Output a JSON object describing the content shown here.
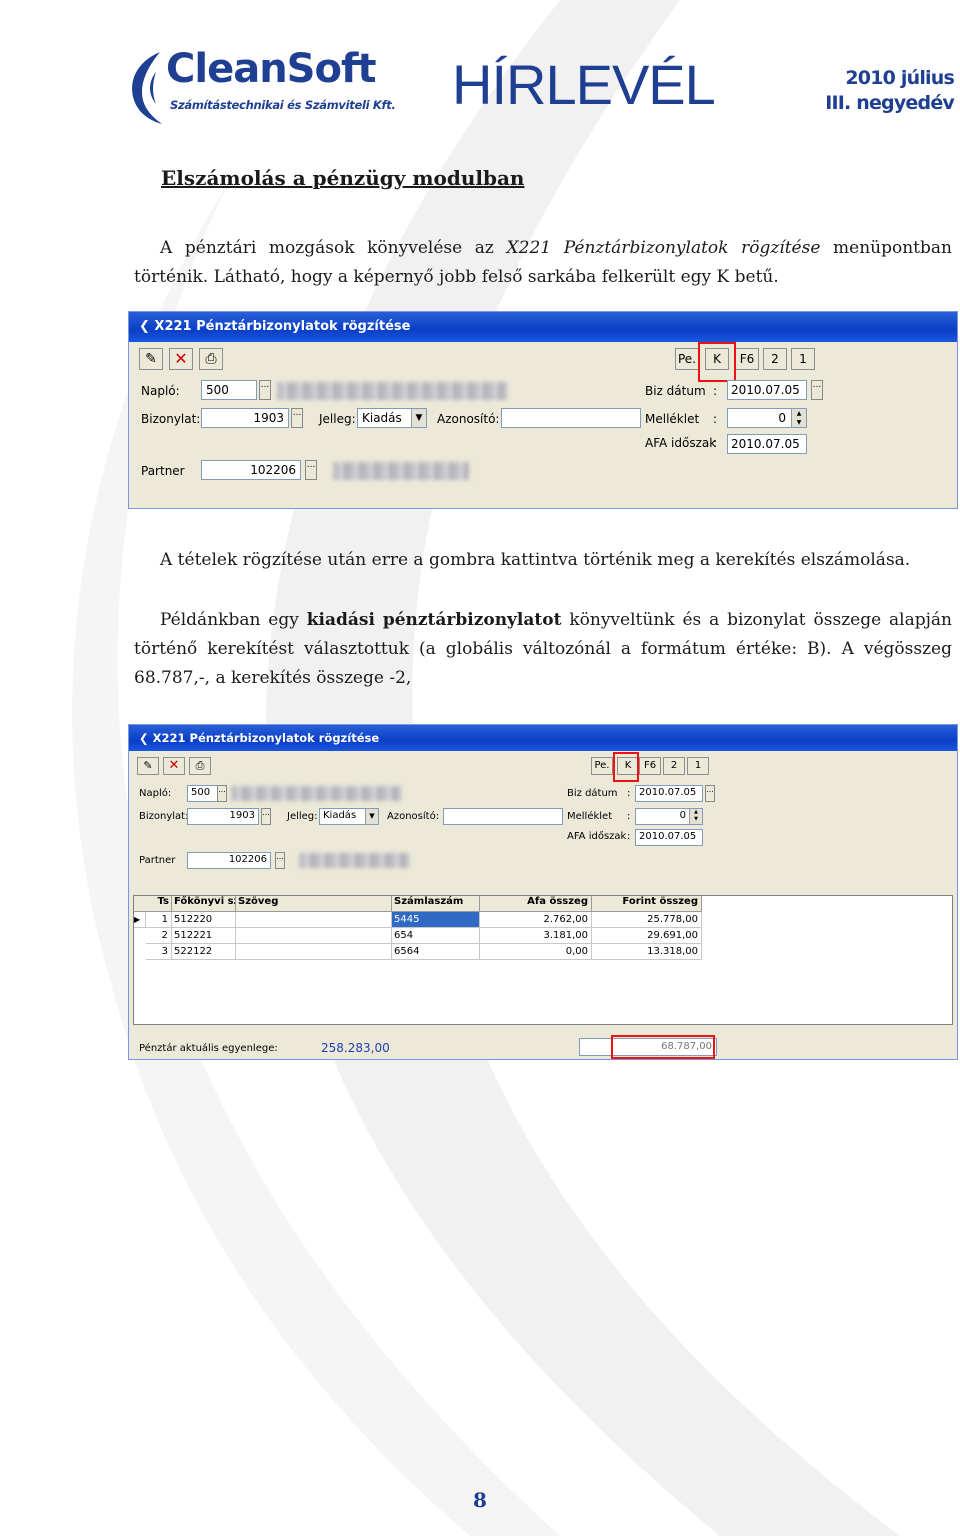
{
  "header": {
    "logo_text": "CleanSoft",
    "logo_subtitle": "Számítástechnikai és Számviteli Kft.",
    "newsletter_title": "HÍRLEVÉL",
    "issue_line1": "2010 július",
    "issue_line2": "III. negyedév"
  },
  "article": {
    "title": "Elszámolás a pénzügy modulban",
    "p1_a": "A pénztári mozgások könyvelése az ",
    "p1_italic": "X221 Pénztárbizonylatok rögzítése",
    "p1_b": " menüpontban történik. Látható, hogy a képernyő jobb felső sarkába felkerült egy K betű.",
    "p2": "A tételek rögzítése után erre a gombra kattintva történik meg a kerekítés elszámolása.",
    "p3_a": "Példánkban egy ",
    "p3_bold1": "kiadási",
    "p3_b": " ",
    "p3_bold2": "pénztárbizonylatot",
    "p3_c": " könyveltünk és a bizonylat összege alapján történő kerekítést választottuk (a globális változónál a formátum értéke: B). A végösszeg 68.787,-, a kerekítés összege -2,"
  },
  "screen": {
    "window_title": "X221 Pénztárbizonylatok rögzítése",
    "buttons": {
      "pe": "Pe.",
      "k": "K",
      "f6": "F6",
      "b2": "2",
      "b1": "1",
      "dots": "..."
    },
    "labels": {
      "naplo": "Napló:",
      "bizonylat": "Bizonylat:",
      "jelleg": "Jelleg:",
      "azonosito": "Azonosító:",
      "partner": "Partner",
      "biz_datum": "Biz dátum",
      "melleklet": "Melléklet",
      "afa_idoszak": "AFA időszak",
      "colon": ":"
    },
    "values": {
      "naplo": "500",
      "bizonylat": "1903",
      "jelleg": "Kiadás",
      "partner": "102206",
      "biz_datum": "2010.07.05",
      "melleklet": "0",
      "afa_idoszak": "2010.07.05"
    }
  },
  "table": {
    "columns": [
      "Ts",
      "Főkönyvi sz.",
      "Szöveg",
      "Számlaszám",
      "Áfa összeg",
      "Forint összeg"
    ],
    "rows": [
      {
        "ts": "1",
        "fokonyv": "512220",
        "szoveg": "",
        "szamla": "5445",
        "afa": "2.762,00",
        "forint": "25.778,00"
      },
      {
        "ts": "2",
        "fokonyv": "512221",
        "szoveg": "",
        "szamla": "654",
        "afa": "3.181,00",
        "forint": "29.691,00"
      },
      {
        "ts": "3",
        "fokonyv": "522122",
        "szoveg": "",
        "szamla": "6564",
        "afa": "0,00",
        "forint": "13.318,00"
      }
    ],
    "current_row_marker": "▶"
  },
  "footer_bar": {
    "balance_label": "Pénztár aktuális egyenlege:",
    "balance_value": "258.283,00",
    "total_value": "68.787,00"
  },
  "page_number": "8",
  "colors": {
    "brand_blue": "#1f3f93",
    "highlight_red": "#e11111",
    "xp_title": "#0a3fc6"
  }
}
